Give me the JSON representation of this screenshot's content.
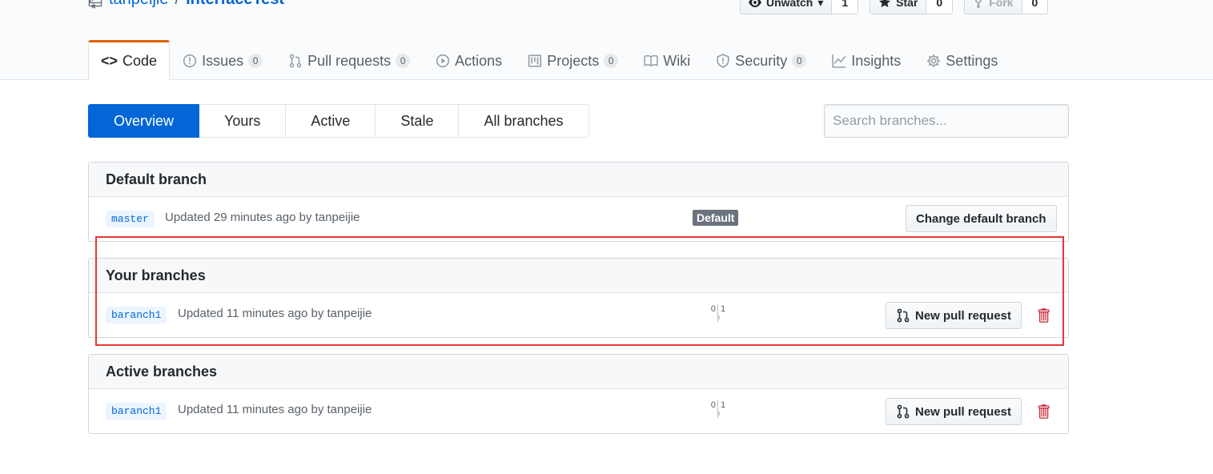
{
  "repo": {
    "owner": "tanpeijie",
    "separator": "/",
    "name": "InterfaceTest"
  },
  "actions": {
    "watch": {
      "label": "Unwatch",
      "count": "1"
    },
    "star": {
      "label": "Star",
      "count": "0"
    },
    "fork": {
      "label": "Fork",
      "count": "0"
    }
  },
  "nav": {
    "code": "Code",
    "issues": {
      "label": "Issues",
      "count": "0"
    },
    "pulls": {
      "label": "Pull requests",
      "count": "0"
    },
    "actions": "Actions",
    "projects": {
      "label": "Projects",
      "count": "0"
    },
    "wiki": "Wiki",
    "security": {
      "label": "Security",
      "count": "0"
    },
    "insights": "Insights",
    "settings": "Settings"
  },
  "subnav": {
    "overview": "Overview",
    "yours": "Yours",
    "active": "Active",
    "stale": "Stale",
    "all": "All branches"
  },
  "search": {
    "placeholder": "Search branches..."
  },
  "default_branch": {
    "header": "Default branch",
    "name": "master",
    "meta": "Updated 29 minutes ago by tanpeijie",
    "label": "Default",
    "button": "Change default branch"
  },
  "your_branches": {
    "header": "Your branches",
    "name": "baranch1",
    "meta": "Updated 11 minutes ago by tanpeijie",
    "behind": "0",
    "ahead": "1",
    "button": "New pull request"
  },
  "active_branches": {
    "header": "Active branches",
    "name": "baranch1",
    "meta": "Updated 11 minutes ago by tanpeijie",
    "behind": "0",
    "ahead": "1",
    "button": "New pull request"
  },
  "colors": {
    "accent": "#0366d6",
    "tab_highlight": "#e36209",
    "danger": "#cb2431",
    "annotation": "#e53935"
  }
}
